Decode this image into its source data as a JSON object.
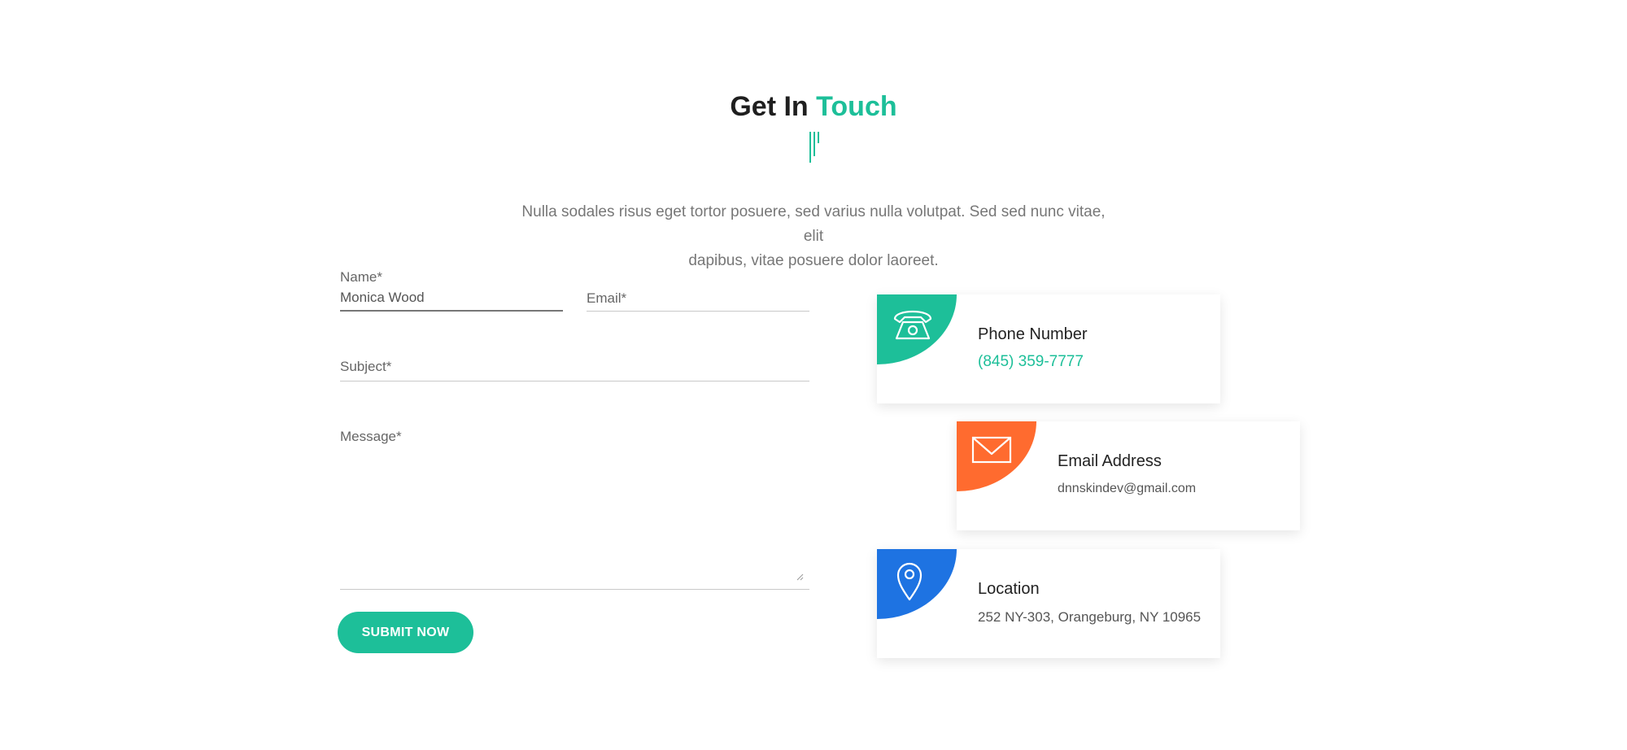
{
  "header": {
    "title_plain": "Get In",
    "title_accent": "Touch",
    "intro_line1": "Nulla sodales risus eget tortor posuere, sed varius nulla volutpat. Sed sed nunc vitae, elit",
    "intro_line2": "dapibus, vitae posuere dolor laoreet."
  },
  "form": {
    "name_label": "Name*",
    "name_value": "Monica Wood",
    "email_label": "Email*",
    "subject_label": "Subject*",
    "message_label": "Message*",
    "submit_label": "SUBMIT NOW"
  },
  "contact": {
    "phone": {
      "title": "Phone Number",
      "value": "(845) 359-7777",
      "icon": "phone-icon",
      "color": "#1dbf99"
    },
    "email": {
      "title": "Email Address",
      "value": "dnnskindev@gmail.com",
      "icon": "envelope-icon",
      "color": "#ff6b2f"
    },
    "location": {
      "title": "Location",
      "value": "252 NY-303, Orangeburg, NY 10965",
      "icon": "map-pin-icon",
      "color": "#1e73e2"
    }
  },
  "colors": {
    "accent": "#1dbf99"
  }
}
